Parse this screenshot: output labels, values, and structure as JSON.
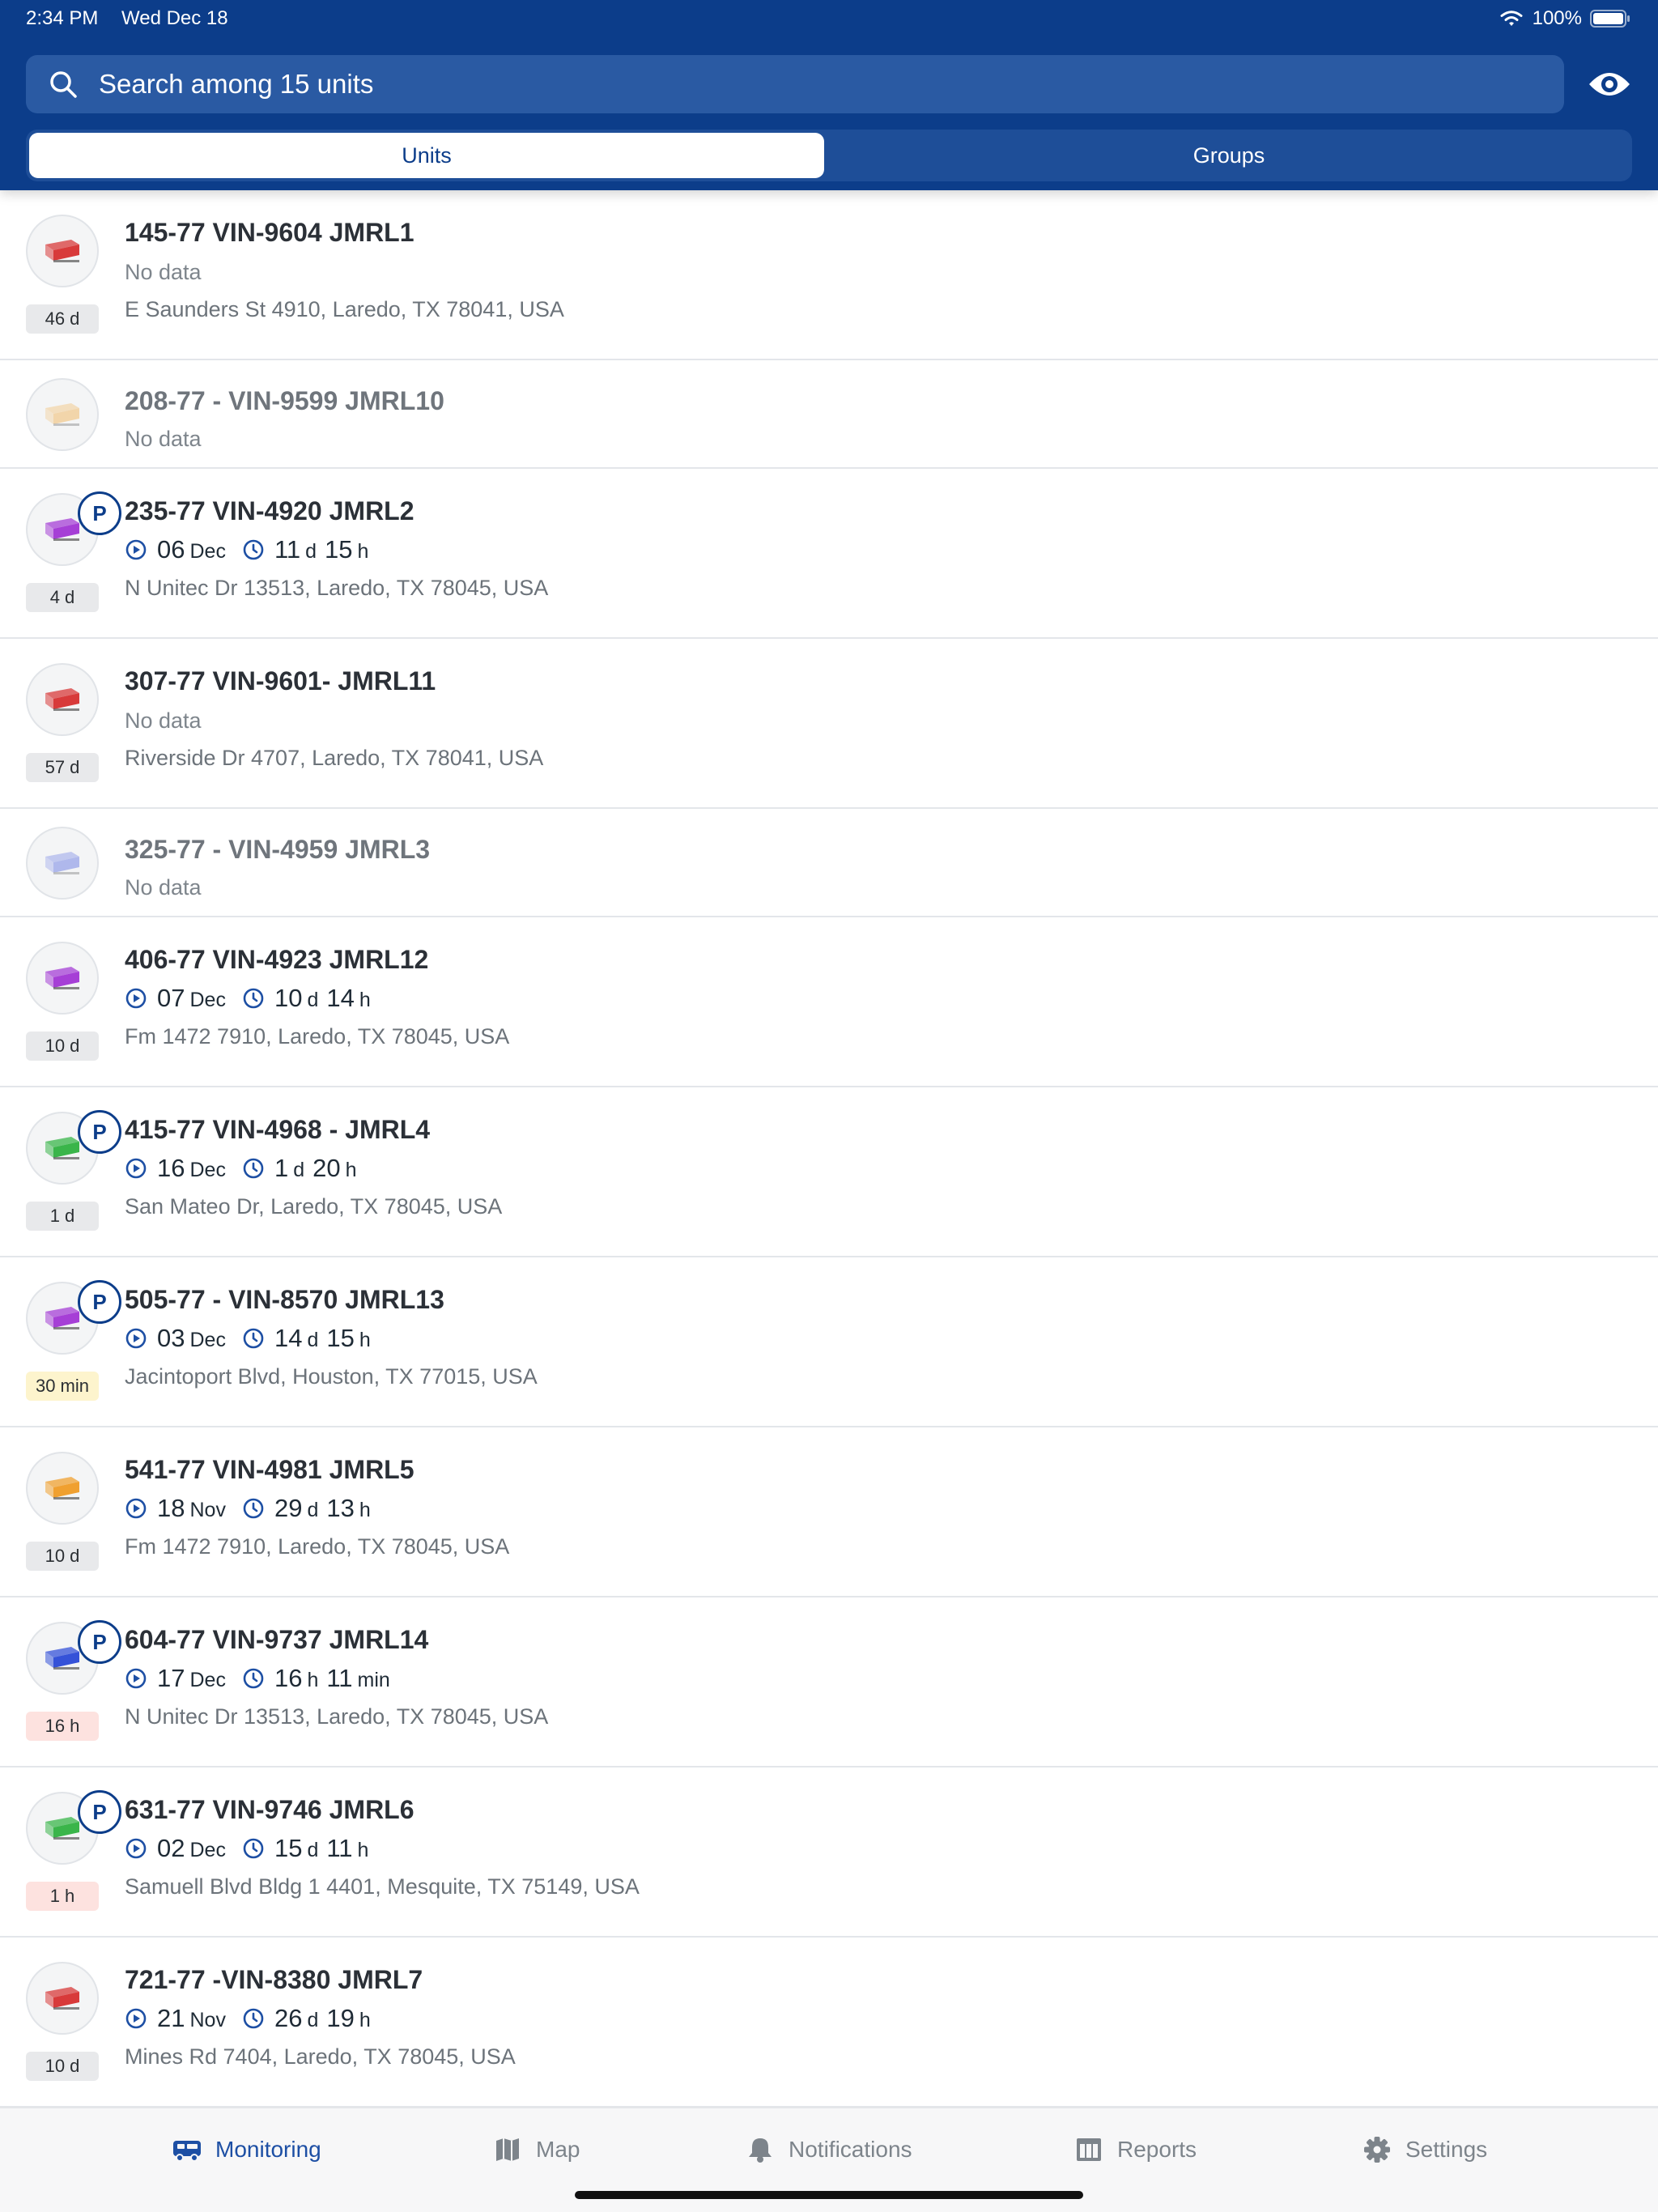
{
  "status_bar": {
    "time": "2:34 PM",
    "date": "Wed Dec 18",
    "battery": "100%"
  },
  "search": {
    "placeholder": "Search among 15 units"
  },
  "segments": {
    "units": "Units",
    "groups": "Groups",
    "selected": "Units"
  },
  "units": [
    {
      "name": "145-77 VIN-9604  JMRL1",
      "color": "#d83a3a",
      "faded": false,
      "parked": false,
      "badge": "46 d",
      "badge_style": "gray",
      "no_data": "No data",
      "trip": null,
      "address": "E Saunders St 4910, Laredo, TX 78041, USA"
    },
    {
      "name": "208-77 - VIN-9599 JMRL10",
      "color": "#f0b050",
      "faded": true,
      "parked": false,
      "badge": null,
      "badge_style": null,
      "no_data": "No data",
      "trip": null,
      "address": null
    },
    {
      "name": "235-77 VIN-4920 JMRL2",
      "color": "#a63fd6",
      "faded": false,
      "parked": true,
      "badge": "4 d",
      "badge_style": "gray",
      "no_data": null,
      "trip": {
        "start_day": "06",
        "start_month": "Dec",
        "dur1_val": "11",
        "dur1_unit": "d",
        "dur2_val": "15",
        "dur2_unit": "h"
      },
      "address": "N Unitec Dr 13513, Laredo, TX 78045, USA"
    },
    {
      "name": "307-77 VIN-9601- JMRL11",
      "color": "#d83a3a",
      "faded": false,
      "parked": false,
      "badge": "57 d",
      "badge_style": "gray",
      "no_data": "No data",
      "trip": null,
      "address": "Riverside Dr 4707, Laredo, TX 78041, USA"
    },
    {
      "name": "325-77 - VIN-4959 JMRL3",
      "color": "#5c6fe0",
      "faded": true,
      "parked": false,
      "badge": null,
      "badge_style": null,
      "no_data": "No data",
      "trip": null,
      "address": null
    },
    {
      "name": "406-77 VIN-4923 JMRL12",
      "color": "#a63fd6",
      "faded": false,
      "parked": false,
      "badge": "10 d",
      "badge_style": "gray",
      "no_data": null,
      "trip": {
        "start_day": "07",
        "start_month": "Dec",
        "dur1_val": "10",
        "dur1_unit": "d",
        "dur2_val": "14",
        "dur2_unit": "h"
      },
      "address": "Fm 1472 7910, Laredo, TX 78045, USA"
    },
    {
      "name": "415-77 VIN-4968 - JMRL4",
      "color": "#3ab54a",
      "faded": false,
      "parked": true,
      "badge": "1 d",
      "badge_style": "gray",
      "no_data": null,
      "trip": {
        "start_day": "16",
        "start_month": "Dec",
        "dur1_val": "1",
        "dur1_unit": "d",
        "dur2_val": "20",
        "dur2_unit": "h"
      },
      "address": "San Mateo Dr, Laredo, TX 78045, USA"
    },
    {
      "name": "505-77 - VIN-8570 JMRL13",
      "color": "#a63fd6",
      "faded": false,
      "parked": true,
      "badge": "30 min",
      "badge_style": "orange",
      "no_data": null,
      "trip": {
        "start_day": "03",
        "start_month": "Dec",
        "dur1_val": "14",
        "dur1_unit": "d",
        "dur2_val": "15",
        "dur2_unit": "h"
      },
      "address": "Jacintoport Blvd, Houston, TX 77015, USA"
    },
    {
      "name": "541-77 VIN-4981 JMRL5",
      "color": "#f0a030",
      "faded": false,
      "parked": false,
      "badge": "10 d",
      "badge_style": "gray",
      "no_data": null,
      "trip": {
        "start_day": "18",
        "start_month": "Nov",
        "dur1_val": "29",
        "dur1_unit": "d",
        "dur2_val": "13",
        "dur2_unit": "h"
      },
      "address": "Fm 1472 7910, Laredo, TX 78045, USA"
    },
    {
      "name": "604-77 VIN-9737 JMRL14",
      "color": "#3552d8",
      "faded": false,
      "parked": true,
      "badge": "16 h",
      "badge_style": "red",
      "no_data": null,
      "trip": {
        "start_day": "17",
        "start_month": "Dec",
        "dur1_val": "16",
        "dur1_unit": "h",
        "dur2_val": "11",
        "dur2_unit": "min"
      },
      "address": "N Unitec Dr 13513, Laredo, TX 78045, USA"
    },
    {
      "name": "631-77 VIN-9746 JMRL6",
      "color": "#3ab54a",
      "faded": false,
      "parked": true,
      "badge": "1 h",
      "badge_style": "red",
      "no_data": null,
      "trip": {
        "start_day": "02",
        "start_month": "Dec",
        "dur1_val": "15",
        "dur1_unit": "d",
        "dur2_val": "11",
        "dur2_unit": "h"
      },
      "address": "Samuell Blvd Bldg 1 4401, Mesquite, TX 75149, USA"
    },
    {
      "name": "721-77 -VIN-8380 JMRL7",
      "color": "#d83a3a",
      "faded": false,
      "parked": false,
      "badge": "10 d",
      "badge_style": "gray",
      "no_data": null,
      "trip": {
        "start_day": "21",
        "start_month": "Nov",
        "dur1_val": "26",
        "dur1_unit": "d",
        "dur2_val": "19",
        "dur2_unit": "h"
      },
      "address": "Mines Rd 7404, Laredo, TX 78045, USA"
    }
  ],
  "parked_label": "P",
  "tabs": [
    {
      "label": "Monitoring",
      "icon": "van-icon",
      "active": true
    },
    {
      "label": "Map",
      "icon": "map-icon",
      "active": false
    },
    {
      "label": "Notifications",
      "icon": "bell-icon",
      "active": false
    },
    {
      "label": "Reports",
      "icon": "table-icon",
      "active": false
    },
    {
      "label": "Settings",
      "icon": "gear-icon",
      "active": false
    }
  ],
  "colors": {
    "header": "#0c3d8a",
    "accent": "#1d4fa4"
  }
}
